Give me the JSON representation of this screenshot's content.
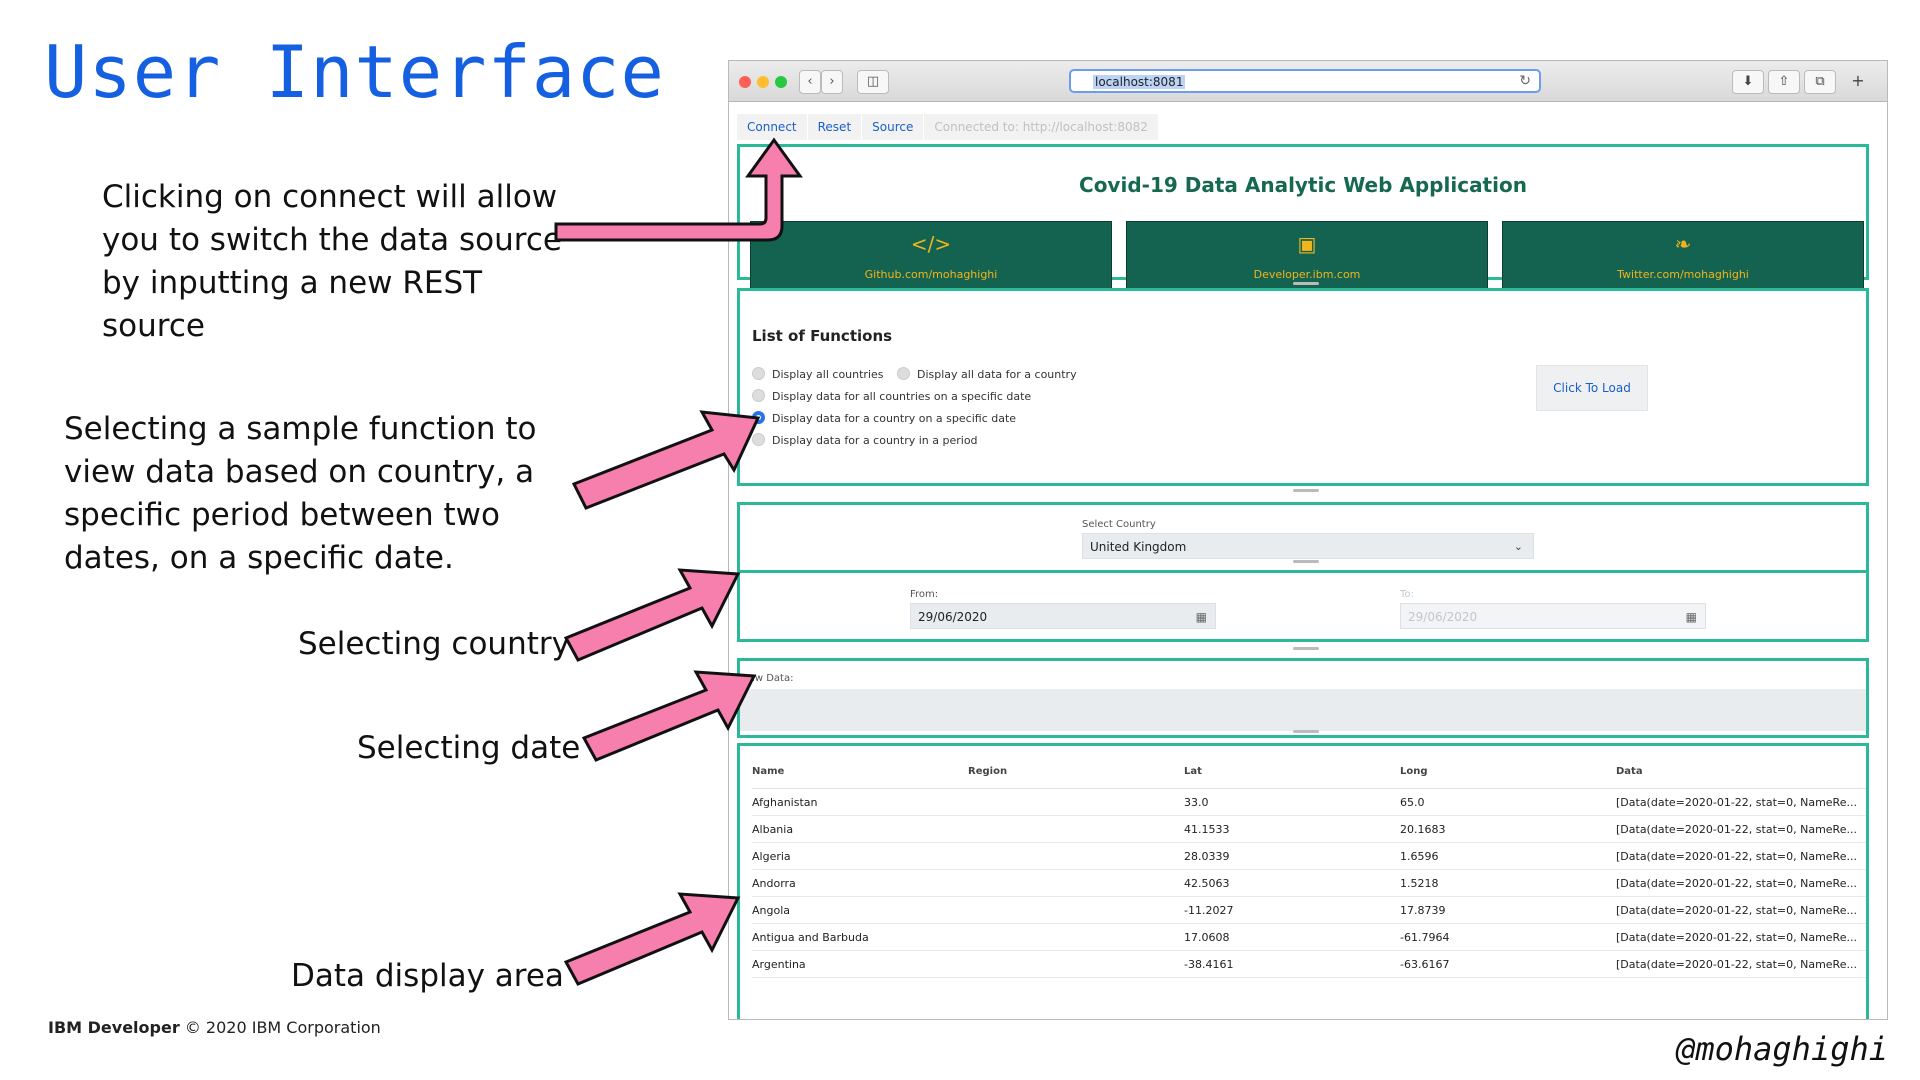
{
  "slide": {
    "title": "User Interface",
    "annotations": [
      "Clicking on connect will allow you to switch the data source by inputting a new REST source",
      "Selecting a sample function to view data based on country, a specific period between two dates, on a specific date.",
      "Selecting country",
      "Selecting date",
      "Data display area"
    ],
    "footer_brand": "IBM Developer",
    "footer_copyright": "© 2020 IBM Corporation",
    "handle": "@mohaghighi",
    "arrow_color": "#f77fae",
    "title_color": "#1560e0"
  },
  "browser": {
    "url": "localhost:8081",
    "traffic_lights": [
      "#fe5f57",
      "#febc2e",
      "#28c840"
    ]
  },
  "app": {
    "nav_tabs": [
      "Connect",
      "Reset",
      "Source"
    ],
    "connection_status": "Connected to: http://localhost:8082",
    "app_title": "Covid-19 Data Analytic Web Application",
    "cards": [
      {
        "icon": "code-icon",
        "label": "Github.com/mohaghighi"
      },
      {
        "icon": "browser-window-icon",
        "label": "Developer.ibm.com"
      },
      {
        "icon": "twitter-icon",
        "label": "Twitter.com/mohaghighi"
      }
    ],
    "functions_heading": "List of Functions",
    "functions": [
      "Display all countries",
      "Display all data for a country",
      "Display data for all countries on a specific date",
      "Display data for a country on a specific date",
      "Display data for a country in a period"
    ],
    "selected_function": "Display data for a country on a specific date",
    "load_button": "Click To Load",
    "country_label": "Select Country",
    "country_value": "United Kingdom",
    "from_label": "From:",
    "from_value": "29/06/2020",
    "to_label": "To:",
    "to_value": "29/06/2020",
    "raw_label": "Raw Data:",
    "accent_color": "#2bb99a",
    "card_color": "#146350",
    "table": {
      "columns": [
        "Name",
        "Region",
        "Lat",
        "Long",
        "Data"
      ],
      "rows": [
        [
          "Afghanistan",
          "",
          "33.0",
          "65.0",
          "[Data(date=2020-01-22, stat=0, NameRe..."
        ],
        [
          "Albania",
          "",
          "41.1533",
          "20.1683",
          "[Data(date=2020-01-22, stat=0, NameRe..."
        ],
        [
          "Algeria",
          "",
          "28.0339",
          "1.6596",
          "[Data(date=2020-01-22, stat=0, NameRe..."
        ],
        [
          "Andorra",
          "",
          "42.5063",
          "1.5218",
          "[Data(date=2020-01-22, stat=0, NameRe..."
        ],
        [
          "Angola",
          "",
          "-11.2027",
          "17.8739",
          "[Data(date=2020-01-22, stat=0, NameRe..."
        ],
        [
          "Antigua and Barbuda",
          "",
          "17.0608",
          "-61.7964",
          "[Data(date=2020-01-22, stat=0, NameRe..."
        ],
        [
          "Argentina",
          "",
          "-38.4161",
          "-63.6167",
          "[Data(date=2020-01-22, stat=0, NameRe..."
        ]
      ]
    }
  }
}
